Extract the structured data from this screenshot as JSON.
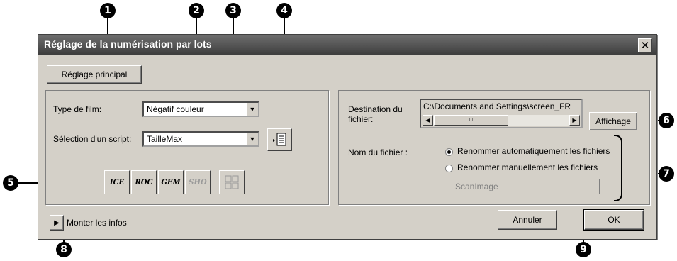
{
  "callouts": [
    "1",
    "2",
    "3",
    "4",
    "5",
    "6",
    "7",
    "8",
    "9"
  ],
  "dialog": {
    "title": "Réglage de la numérisation par lots",
    "close_glyph": "✕",
    "main_settings_label": "Réglage principal",
    "film_type_label": "Type de film:",
    "film_type_value": "Négatif couleur",
    "script_label": "Sélection d'un script:",
    "script_value": "TailleMax",
    "script_button_icon": "script-list-icon",
    "tools": [
      "ICE",
      "ROC",
      "GEM",
      "SHO",
      "grid"
    ],
    "destination_label": "Destination du fichier:",
    "destination_value": "C:\\Documents and Settings\\screen_FR",
    "scroll_thumb": "III",
    "browse_label": "Affichage",
    "filename_label": "Nom du fichier :",
    "radio_auto_label": "Renommer automatiquement les fichiers",
    "radio_manual_label": "Renommer manuellement les fichiers",
    "manual_name_value": "ScanImage",
    "show_info_label": "Monter les  infos",
    "cancel_label": "Annuler",
    "ok_label": "OK"
  }
}
